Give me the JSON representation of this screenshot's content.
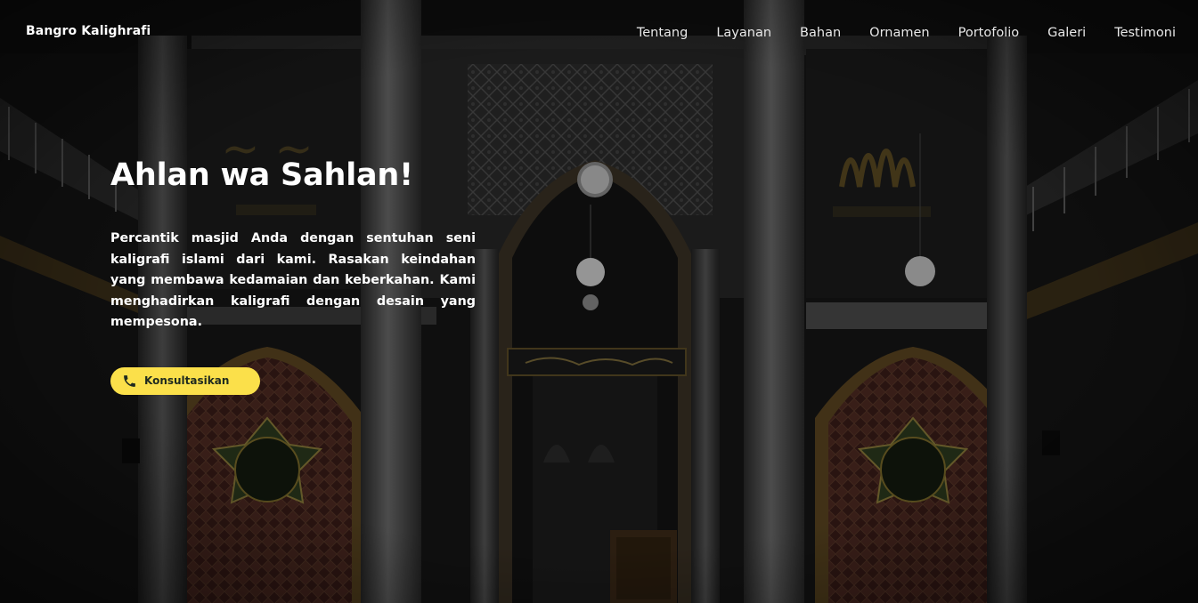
{
  "brand": {
    "name": "Bangro Kalighrafi"
  },
  "nav": {
    "items": [
      {
        "label": "Tentang"
      },
      {
        "label": "Layanan"
      },
      {
        "label": "Bahan"
      },
      {
        "label": "Ornamen"
      },
      {
        "label": "Portofolio"
      },
      {
        "label": "Galeri"
      },
      {
        "label": "Testimoni"
      }
    ]
  },
  "hero": {
    "headline": "Ahlan wa Sahlan!",
    "body": "Percantik masjid Anda dengan sentuhan seni kaligrafi islami dari kami. Rasakan keindahan yang membawa kedamaian dan keberkahan. Kami menghadirkan kaligrafi dengan desain yang mempesona.",
    "cta_label": "Konsultasikan",
    "cta_icon": "phone-icon",
    "background_image": "mosque-interior-image"
  },
  "colors": {
    "accent": "#fbe04a",
    "cta_text": "#1f2a1f",
    "text": "#ffffff"
  }
}
